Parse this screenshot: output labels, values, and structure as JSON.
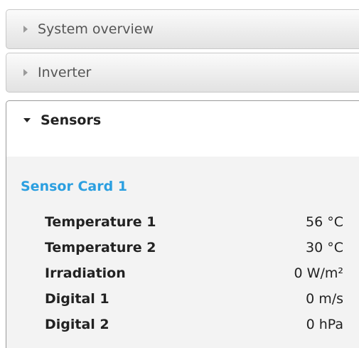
{
  "accordion": {
    "sections": [
      {
        "label": "System overview",
        "state": "collapsed"
      },
      {
        "label": "Inverter",
        "state": "collapsed"
      },
      {
        "label": "Sensors",
        "state": "expanded"
      }
    ]
  },
  "sensors_panel": {
    "card_title": "Sensor Card 1",
    "rows": [
      {
        "label": "Temperature 1",
        "value": "56 °C"
      },
      {
        "label": "Temperature 2",
        "value": "30 °C"
      },
      {
        "label": "Irradiation",
        "value": "0 W/m²"
      },
      {
        "label": "Digital 1",
        "value": "0 m/s"
      },
      {
        "label": "Digital 2",
        "value": "0 hPa"
      }
    ]
  },
  "colors": {
    "card_title": "#2b9fe0",
    "header_gradient_top": "#fbfbfb",
    "header_gradient_bottom": "#e2e2e2",
    "panel_background": "#f3f3f3",
    "text": "#222222"
  },
  "icons": {
    "collapsed": "triangle-right-icon",
    "expanded": "triangle-down-icon"
  }
}
